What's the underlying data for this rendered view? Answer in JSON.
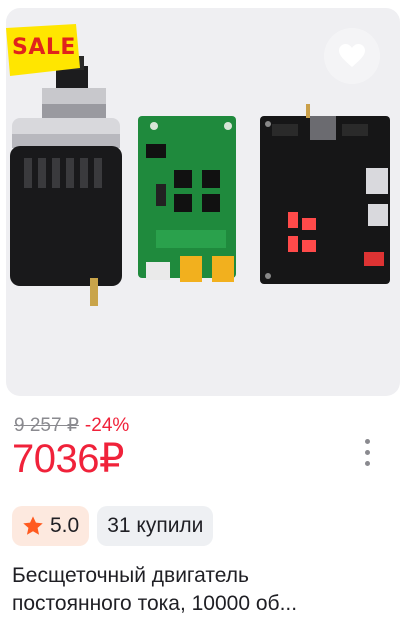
{
  "badge": {
    "sale_label": "SALE"
  },
  "price": {
    "old": "9 257 ₽",
    "discount": "-24%",
    "current": "7036₽"
  },
  "rating": {
    "value": "5.0"
  },
  "sales": {
    "bought_label": "31 купили"
  },
  "product": {
    "title_line1": "Бесщеточный двигатель",
    "title_line2": "постоянного тока, 10000 об..."
  },
  "icons": [
    "heart-icon",
    "star-icon",
    "more-vertical-icon"
  ],
  "colors": {
    "price": "#f0223a",
    "sale_bg": "#ffe600",
    "sale_text": "#e0231c",
    "rating_bg": "#fde9df",
    "star": "#ff5a1f"
  }
}
